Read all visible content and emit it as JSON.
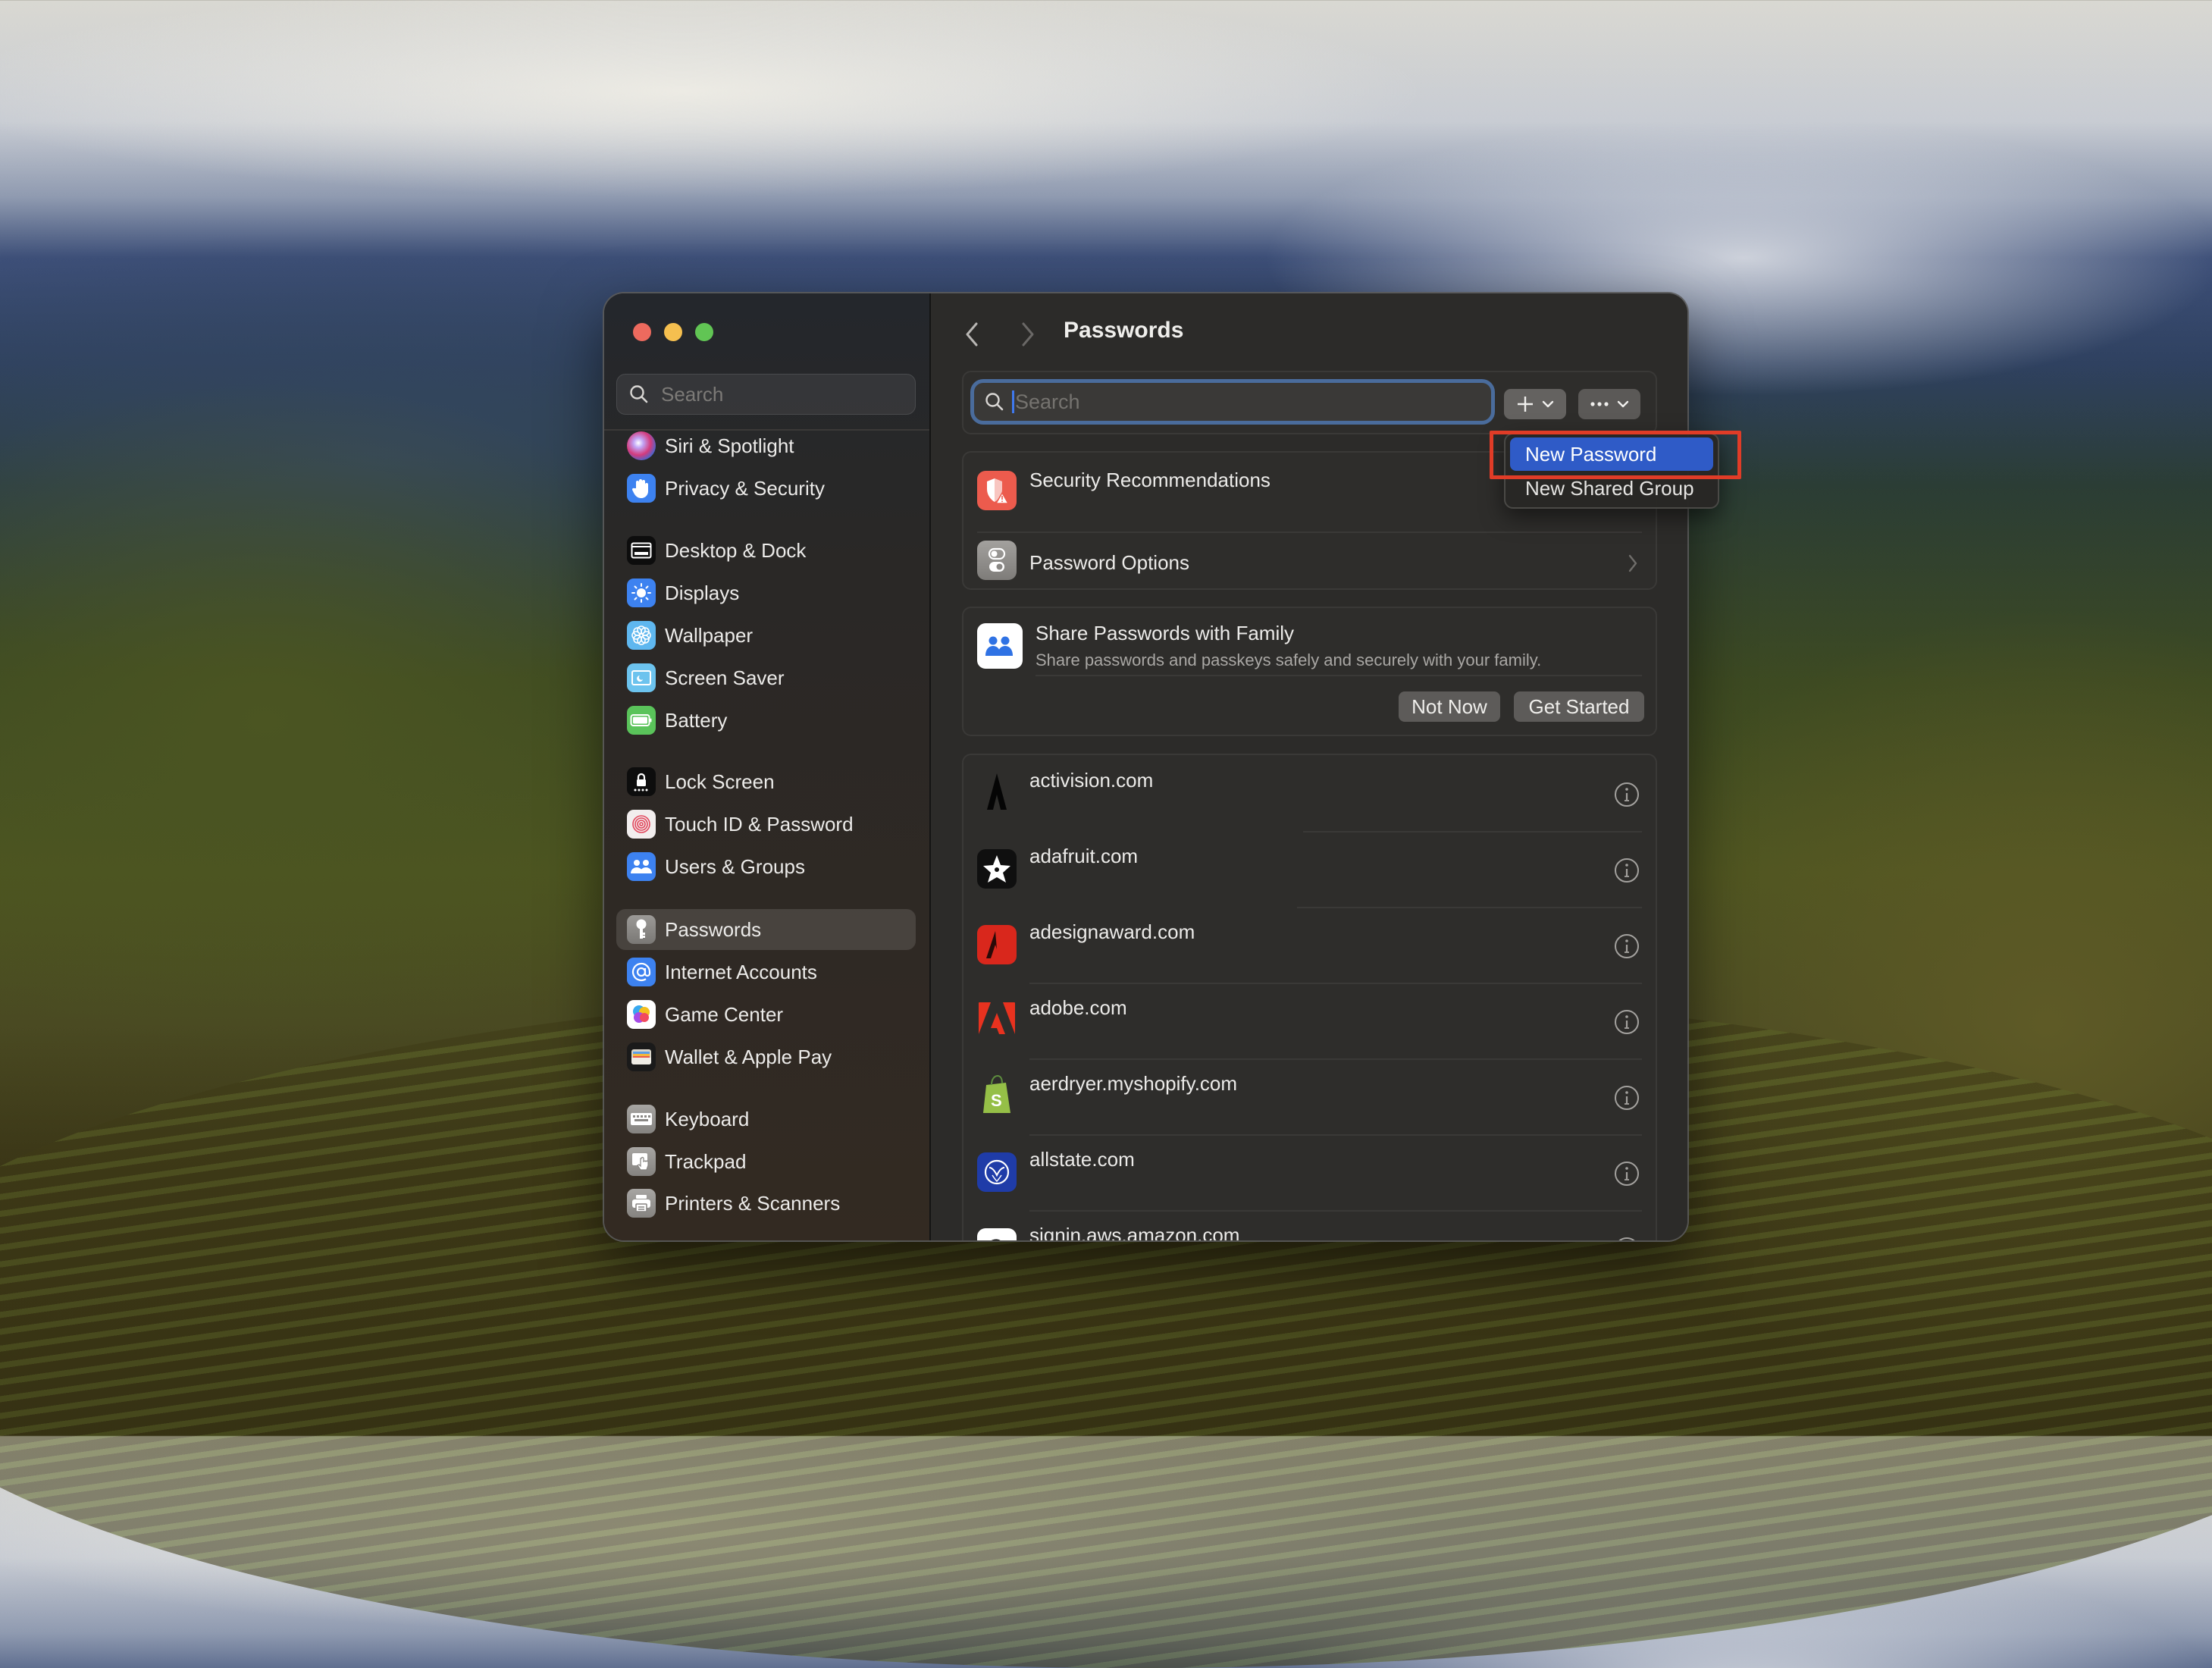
{
  "window": {
    "title": "Passwords",
    "traffic_lights": [
      "close",
      "minimize",
      "zoom"
    ]
  },
  "sidebar": {
    "search_placeholder": "Search",
    "items": [
      {
        "label": "Siri & Spotlight",
        "icon": "siri-icon"
      },
      {
        "label": "Privacy & Security",
        "icon": "hand-icon"
      },
      {
        "label": "Desktop & Dock",
        "icon": "dock-icon"
      },
      {
        "label": "Displays",
        "icon": "sun-icon"
      },
      {
        "label": "Wallpaper",
        "icon": "flower-icon"
      },
      {
        "label": "Screen Saver",
        "icon": "screensaver-icon"
      },
      {
        "label": "Battery",
        "icon": "battery-icon"
      },
      {
        "label": "Lock Screen",
        "icon": "lock-icon"
      },
      {
        "label": "Touch ID & Password",
        "icon": "fingerprint-icon"
      },
      {
        "label": "Users & Groups",
        "icon": "users-icon"
      },
      {
        "label": "Passwords",
        "icon": "key-icon",
        "selected": true
      },
      {
        "label": "Internet Accounts",
        "icon": "at-icon"
      },
      {
        "label": "Game Center",
        "icon": "game-center-icon"
      },
      {
        "label": "Wallet & Apple Pay",
        "icon": "wallet-icon"
      },
      {
        "label": "Keyboard",
        "icon": "keyboard-icon"
      },
      {
        "label": "Trackpad",
        "icon": "trackpad-icon"
      },
      {
        "label": "Printers & Scanners",
        "icon": "printer-icon"
      }
    ]
  },
  "main": {
    "title": "Passwords",
    "search": {
      "placeholder": "Search",
      "value": ""
    },
    "add_button_label": "+",
    "more_button_label": "···",
    "add_menu": {
      "items": [
        {
          "label": "New Password",
          "highlighted": true
        },
        {
          "label": "New Shared Group",
          "highlighted": false
        }
      ]
    },
    "settings_rows": [
      {
        "label": "Security Recommendations",
        "icon": "security-recommendations-icon"
      },
      {
        "label": "Password Options",
        "icon": "password-options-icon"
      }
    ],
    "share_card": {
      "title": "Share Passwords with Family",
      "subtitle": "Share passwords and passkeys safely and securely with your family.",
      "not_now_label": "Not Now",
      "get_started_label": "Get Started"
    },
    "accounts": [
      {
        "site": "activision.com",
        "icon": "activision-icon"
      },
      {
        "site": "adafruit.com",
        "icon": "adafruit-icon"
      },
      {
        "site": "adesignaward.com",
        "icon": "adesignaward-icon"
      },
      {
        "site": "adobe.com",
        "icon": "adobe-icon"
      },
      {
        "site": "aerdryer.myshopify.com",
        "icon": "shopify-icon"
      },
      {
        "site": "allstate.com",
        "icon": "allstate-icon"
      },
      {
        "site": "signin.aws.amazon.com",
        "icon": "amazon-icon"
      }
    ]
  },
  "colors": {
    "accent": "#2f5bc7",
    "annotation": "#e03c27",
    "close": "#ed6a5e",
    "minimize": "#f5bf4f",
    "zoom": "#61c554"
  }
}
